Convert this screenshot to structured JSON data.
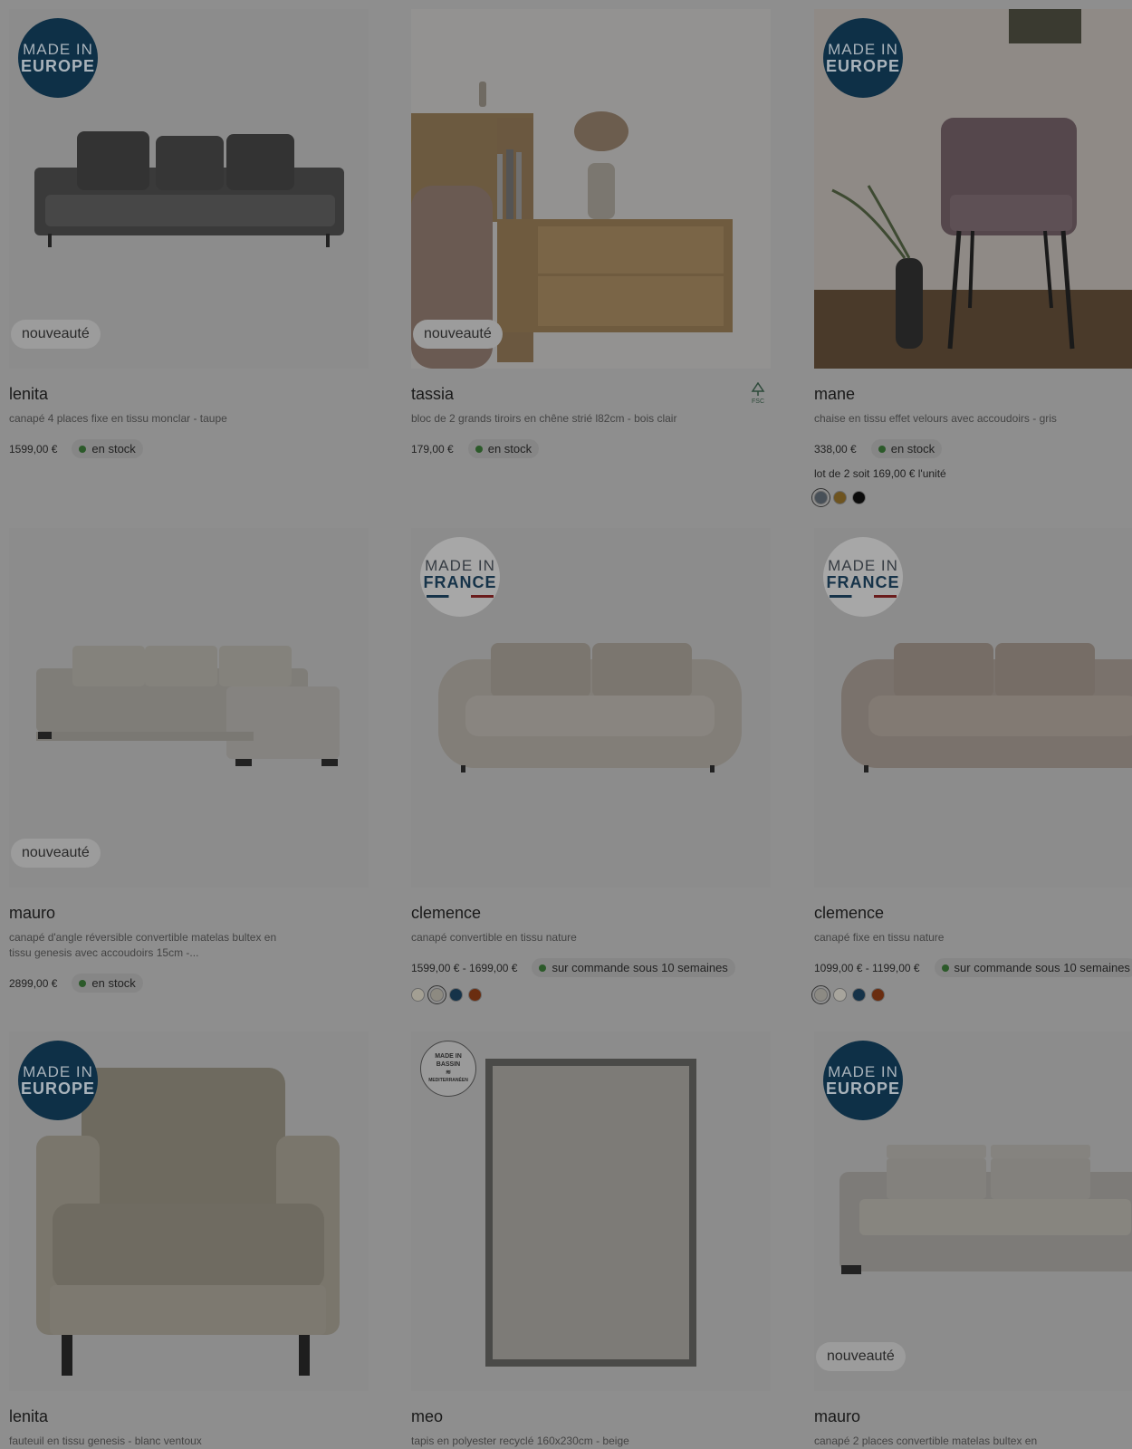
{
  "products": [
    {
      "title": "lenita",
      "desc": "canapé 4 places fixe en tissu monclar - taupe",
      "price": "1599,00 €",
      "stock": "en stock",
      "tag": "nouveauté",
      "badge_eu": [
        "MADE IN",
        "EUROPE"
      ]
    },
    {
      "title": "tassia",
      "desc": "bloc de 2 grands tiroirs en chêne strié l82cm - bois clair",
      "price": "179,00 €",
      "stock": "en stock",
      "tag": "nouveauté",
      "fsc": "FSC"
    },
    {
      "title": "mane",
      "desc": "chaise en tissu effet velours avec accoudoirs - gris",
      "price": "338,00 €",
      "stock": "en stock",
      "lot": "lot de 2 soit 169,00 € l'unité",
      "badge_eu": [
        "MADE IN",
        "EUROPE"
      ],
      "swatches": [
        "#485058",
        "#6e5420",
        "#0c0c0c"
      ]
    },
    {
      "title": "mauro",
      "desc": "canapé d'angle réversible convertible matelas bultex en tissu genesis avec accoudoirs 15cm -...",
      "price": "2899,00 €",
      "stock": "en stock",
      "tag": "nouveauté"
    },
    {
      "title": "clemence",
      "desc": "canapé convertible en tissu nature",
      "price": "1599,00 € - 1699,00 €",
      "stock": "sur commande sous 10 semaines",
      "badge_fr": [
        "MADE IN",
        "FRANCE"
      ],
      "swatches": [
        "#a39f93",
        "#8d8a81",
        "#163349",
        "#6a2d10"
      ]
    },
    {
      "title": "clemence",
      "desc": "canapé fixe en tissu nature",
      "price": "1099,00 € - 1199,00 €",
      "stock": "sur commande sous 10 semaines",
      "badge_fr": [
        "MADE IN",
        "FRANCE"
      ],
      "swatches": [
        "#8c8a83",
        "#a7a49c",
        "#163349",
        "#6a2d10"
      ]
    },
    {
      "title": "lenita",
      "desc": "fauteuil en tissu genesis - blanc ventoux",
      "badge_eu": [
        "MADE IN",
        "EUROPE"
      ]
    },
    {
      "title": "meo",
      "desc": "tapis en polyester recyclé 160x230cm - beige",
      "badge_med": [
        "MADE IN",
        "BASSIN",
        "MEDITERRANÉEN"
      ]
    },
    {
      "title": "mauro",
      "desc": "canapé 2 places convertible matelas bultex en",
      "tag": "nouveauté",
      "badge_eu": [
        "MADE IN",
        "EUROPE"
      ]
    }
  ]
}
